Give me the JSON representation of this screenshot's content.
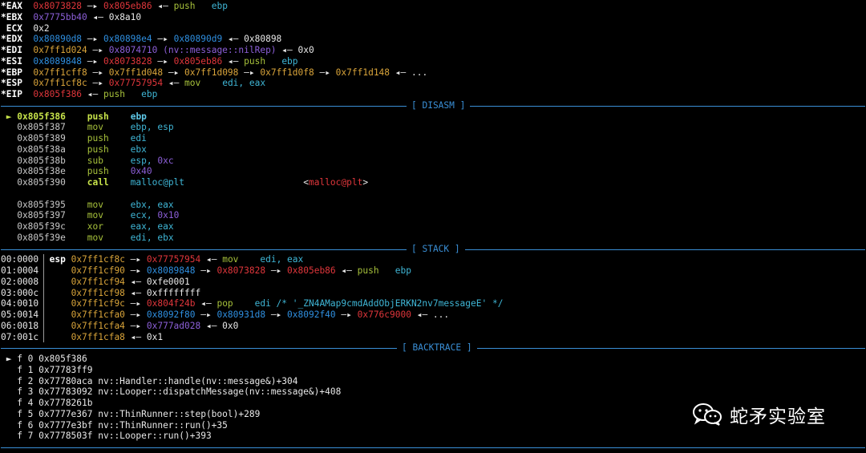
{
  "registers": [
    [
      {
        "t": "*EAX  ",
        "c": "bwhite"
      },
      {
        "t": "0x8073828",
        "c": "red"
      },
      {
        "t": " —▸ ",
        "c": "white"
      },
      {
        "t": "0x805eb86",
        "c": "red"
      },
      {
        "t": " ◂— ",
        "c": "white"
      },
      {
        "t": "push",
        "c": "green"
      },
      {
        "t": "   ebp",
        "c": "cyan"
      }
    ],
    [
      {
        "t": "*EBX  ",
        "c": "bwhite"
      },
      {
        "t": "0x7775bb40",
        "c": "purple"
      },
      {
        "t": " ◂— 0x8a10",
        "c": "white"
      }
    ],
    [
      {
        "t": " ECX  ",
        "c": "bwhite"
      },
      {
        "t": "0x2",
        "c": "white"
      }
    ],
    [
      {
        "t": "*EDX  ",
        "c": "bwhite"
      },
      {
        "t": "0x80890d8",
        "c": "blue"
      },
      {
        "t": " —▸ ",
        "c": "white"
      },
      {
        "t": "0x80898e4",
        "c": "blue"
      },
      {
        "t": " —▸ ",
        "c": "white"
      },
      {
        "t": "0x80890d9",
        "c": "blue"
      },
      {
        "t": " ◂— 0x80898",
        "c": "white"
      }
    ],
    [
      {
        "t": "*EDI  ",
        "c": "bwhite"
      },
      {
        "t": "0x7ff1d024",
        "c": "yellow"
      },
      {
        "t": " —▸ ",
        "c": "white"
      },
      {
        "t": "0x8074710",
        "c": "purple"
      },
      {
        "t": " (nv::message::nilRep)",
        "c": "purple"
      },
      {
        "t": " ◂— 0x0",
        "c": "white"
      }
    ],
    [
      {
        "t": "*ESI  ",
        "c": "bwhite"
      },
      {
        "t": "0x8089848",
        "c": "blue"
      },
      {
        "t": " —▸ ",
        "c": "white"
      },
      {
        "t": "0x8073828",
        "c": "red"
      },
      {
        "t": " —▸ ",
        "c": "white"
      },
      {
        "t": "0x805eb86",
        "c": "red"
      },
      {
        "t": " ◂— ",
        "c": "white"
      },
      {
        "t": "push",
        "c": "green"
      },
      {
        "t": "   ebp",
        "c": "cyan"
      }
    ],
    [
      {
        "t": "*EBP  ",
        "c": "bwhite"
      },
      {
        "t": "0x7ff1cff8",
        "c": "yellow"
      },
      {
        "t": " —▸ ",
        "c": "white"
      },
      {
        "t": "0x7ff1d048",
        "c": "yellow"
      },
      {
        "t": " —▸ ",
        "c": "white"
      },
      {
        "t": "0x7ff1d098",
        "c": "yellow"
      },
      {
        "t": " —▸ ",
        "c": "white"
      },
      {
        "t": "0x7ff1d0f8",
        "c": "yellow"
      },
      {
        "t": " —▸ ",
        "c": "white"
      },
      {
        "t": "0x7ff1d148",
        "c": "yellow"
      },
      {
        "t": " ◂— ...",
        "c": "white"
      }
    ],
    [
      {
        "t": "*ESP  ",
        "c": "bwhite"
      },
      {
        "t": "0x7ff1cf8c",
        "c": "yellow"
      },
      {
        "t": " —▸ ",
        "c": "white"
      },
      {
        "t": "0x77757954",
        "c": "red"
      },
      {
        "t": " ◂— ",
        "c": "white"
      },
      {
        "t": "mov",
        "c": "green"
      },
      {
        "t": "    edi, eax",
        "c": "cyan"
      }
    ],
    [
      {
        "t": "*EIP  ",
        "c": "bwhite"
      },
      {
        "t": "0x805f386",
        "c": "red"
      },
      {
        "t": " ◂— ",
        "c": "white"
      },
      {
        "t": "push",
        "c": "green"
      },
      {
        "t": "   ebp",
        "c": "cyan"
      }
    ]
  ],
  "sections": {
    "disasm": "[ DISASM ]",
    "stack": "[ STACK ]",
    "backtrace": "[ BACKTRACE ]"
  },
  "disasm": [
    [
      {
        "t": " ► ",
        "c": "bgreen"
      },
      {
        "t": "0x805f386",
        "c": "bgreen"
      },
      {
        "t": "    ",
        "c": "white"
      },
      {
        "t": "push",
        "c": "bgreen"
      },
      {
        "t": "    ",
        "c": "white"
      },
      {
        "t": "ebp",
        "c": "bcyan"
      }
    ],
    [
      {
        "t": "   0x805f387",
        "c": "gray"
      },
      {
        "t": "    ",
        "c": "white"
      },
      {
        "t": "mov",
        "c": "green"
      },
      {
        "t": "     ebp, esp",
        "c": "cyan"
      }
    ],
    [
      {
        "t": "   0x805f389",
        "c": "gray"
      },
      {
        "t": "    ",
        "c": "white"
      },
      {
        "t": "push",
        "c": "green"
      },
      {
        "t": "    edi",
        "c": "cyan"
      }
    ],
    [
      {
        "t": "   0x805f38a",
        "c": "gray"
      },
      {
        "t": "    ",
        "c": "white"
      },
      {
        "t": "push",
        "c": "green"
      },
      {
        "t": "    ebx",
        "c": "cyan"
      }
    ],
    [
      {
        "t": "   0x805f38b",
        "c": "gray"
      },
      {
        "t": "    ",
        "c": "white"
      },
      {
        "t": "sub",
        "c": "green"
      },
      {
        "t": "     esp, ",
        "c": "cyan"
      },
      {
        "t": "0xc",
        "c": "purple"
      }
    ],
    [
      {
        "t": "   0x805f38e",
        "c": "gray"
      },
      {
        "t": "    ",
        "c": "white"
      },
      {
        "t": "push",
        "c": "green"
      },
      {
        "t": "    ",
        "c": "white"
      },
      {
        "t": "0x40",
        "c": "purple"
      }
    ],
    [
      {
        "t": "   0x805f390",
        "c": "gray"
      },
      {
        "t": "    ",
        "c": "white"
      },
      {
        "t": "call",
        "c": "bgreen"
      },
      {
        "t": "    malloc@plt",
        "c": "cyan"
      },
      {
        "t": "                      <",
        "c": "white"
      },
      {
        "t": "malloc@plt",
        "c": "red"
      },
      {
        "t": ">",
        "c": "white"
      }
    ],
    [
      {
        "t": " ",
        "c": "white"
      }
    ],
    [
      {
        "t": "   0x805f395",
        "c": "gray"
      },
      {
        "t": "    ",
        "c": "white"
      },
      {
        "t": "mov",
        "c": "green"
      },
      {
        "t": "     ebx, eax",
        "c": "cyan"
      }
    ],
    [
      {
        "t": "   0x805f397",
        "c": "gray"
      },
      {
        "t": "    ",
        "c": "white"
      },
      {
        "t": "mov",
        "c": "green"
      },
      {
        "t": "     ecx, ",
        "c": "cyan"
      },
      {
        "t": "0x10",
        "c": "purple"
      }
    ],
    [
      {
        "t": "   0x805f39c",
        "c": "gray"
      },
      {
        "t": "    ",
        "c": "white"
      },
      {
        "t": "xor",
        "c": "green"
      },
      {
        "t": "     eax, eax",
        "c": "cyan"
      }
    ],
    [
      {
        "t": "   0x805f39e",
        "c": "gray"
      },
      {
        "t": "    ",
        "c": "white"
      },
      {
        "t": "mov",
        "c": "green"
      },
      {
        "t": "     edi, ebx",
        "c": "cyan"
      }
    ]
  ],
  "stack": [
    [
      {
        "t": "00:0000  ",
        "c": "white"
      },
      {
        "t": "esp ",
        "c": "bwhite"
      },
      {
        "t": "0x7ff1cf8c",
        "c": "yellow"
      },
      {
        "t": " —▸ ",
        "c": "white"
      },
      {
        "t": "0x77757954",
        "c": "red"
      },
      {
        "t": " ◂— ",
        "c": "white"
      },
      {
        "t": "mov",
        "c": "green"
      },
      {
        "t": "    edi, eax",
        "c": "cyan"
      }
    ],
    [
      {
        "t": "01:0004      ",
        "c": "white"
      },
      {
        "t": "0x7ff1cf90",
        "c": "yellow"
      },
      {
        "t": " —▸ ",
        "c": "white"
      },
      {
        "t": "0x8089848",
        "c": "blue"
      },
      {
        "t": " —▸ ",
        "c": "white"
      },
      {
        "t": "0x8073828",
        "c": "red"
      },
      {
        "t": " —▸ ",
        "c": "white"
      },
      {
        "t": "0x805eb86",
        "c": "red"
      },
      {
        "t": " ◂— ",
        "c": "white"
      },
      {
        "t": "push",
        "c": "green"
      },
      {
        "t": "   ebp",
        "c": "cyan"
      }
    ],
    [
      {
        "t": "02:0008      ",
        "c": "white"
      },
      {
        "t": "0x7ff1cf94",
        "c": "yellow"
      },
      {
        "t": " ◂— 0xfe0001",
        "c": "white"
      }
    ],
    [
      {
        "t": "03:000c      ",
        "c": "white"
      },
      {
        "t": "0x7ff1cf98",
        "c": "yellow"
      },
      {
        "t": " ◂— 0xffffffff",
        "c": "white"
      }
    ],
    [
      {
        "t": "04:0010      ",
        "c": "white"
      },
      {
        "t": "0x7ff1cf9c",
        "c": "yellow"
      },
      {
        "t": " —▸ ",
        "c": "white"
      },
      {
        "t": "0x804f24b",
        "c": "red"
      },
      {
        "t": " ◂— ",
        "c": "white"
      },
      {
        "t": "pop",
        "c": "green"
      },
      {
        "t": "    edi /* '_ZN4AMap9cmdAddObjERKN2nv7messageE' */",
        "c": "cyan"
      }
    ],
    [
      {
        "t": "05:0014      ",
        "c": "white"
      },
      {
        "t": "0x7ff1cfa0",
        "c": "yellow"
      },
      {
        "t": " —▸ ",
        "c": "white"
      },
      {
        "t": "0x8092f80",
        "c": "blue"
      },
      {
        "t": " —▸ ",
        "c": "white"
      },
      {
        "t": "0x80931d8",
        "c": "blue"
      },
      {
        "t": " —▸ ",
        "c": "white"
      },
      {
        "t": "0x8092f40",
        "c": "blue"
      },
      {
        "t": " —▸ ",
        "c": "white"
      },
      {
        "t": "0x776c9000",
        "c": "red"
      },
      {
        "t": " ◂— ...",
        "c": "white"
      }
    ],
    [
      {
        "t": "06:0018      ",
        "c": "white"
      },
      {
        "t": "0x7ff1cfa4",
        "c": "yellow"
      },
      {
        "t": " —▸ ",
        "c": "white"
      },
      {
        "t": "0x777ad028",
        "c": "purple"
      },
      {
        "t": " ◂— 0x0",
        "c": "white"
      }
    ],
    [
      {
        "t": "07:001c      ",
        "c": "white"
      },
      {
        "t": "0x7ff1cfa8",
        "c": "yellow"
      },
      {
        "t": " ◂— 0x1",
        "c": "white"
      }
    ]
  ],
  "backtrace": [
    [
      {
        "t": " ► f 0 0x805f386",
        "c": "white"
      }
    ],
    [
      {
        "t": "   f 1 0x77783ff9",
        "c": "white"
      }
    ],
    [
      {
        "t": "   f 2 0x77780aca nv::Handler::handle(nv::message&)+304",
        "c": "white"
      }
    ],
    [
      {
        "t": "   f 3 0x77783092 nv::Looper::dispatchMessage(nv::message&)+408",
        "c": "white"
      }
    ],
    [
      {
        "t": "   f 4 0x7778261b",
        "c": "white"
      }
    ],
    [
      {
        "t": "   f 5 0x7777e367 nv::ThinRunner::step(bool)+289",
        "c": "white"
      }
    ],
    [
      {
        "t": "   f 6 0x7777e3bf nv::ThinRunner::run()+35",
        "c": "white"
      }
    ],
    [
      {
        "t": "   f 7 0x7778503f nv::Looper::run()+393",
        "c": "white"
      }
    ]
  ],
  "watermark": {
    "text": "蛇矛实验室",
    "icon": "wechat-icon"
  },
  "colors": {
    "background": "#000000",
    "separator": "#3a8fd6",
    "red": "#e0363b",
    "purple": "#8c5fd8",
    "blue": "#2f8fe0",
    "yellow": "#d9a43a",
    "green": "#a7c13b",
    "cyan": "#3fb6d6"
  }
}
